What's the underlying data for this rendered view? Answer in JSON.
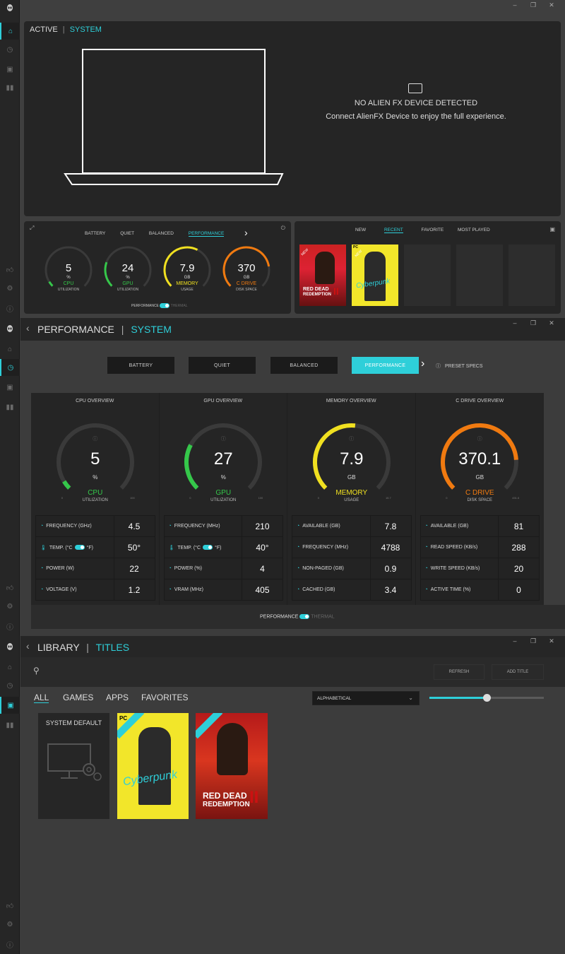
{
  "colors": {
    "accent": "#2ecfd9",
    "cpu": "#35c74a",
    "gpu": "#35c74a",
    "memory": "#f0e020",
    "cdrive": "#f07a10"
  },
  "window_controls": [
    "–",
    "❐",
    "✕"
  ],
  "home": {
    "breadcrumb": {
      "left": "ACTIVE",
      "sep": "|",
      "right": "SYSTEM"
    },
    "alienfx": {
      "title": "NO ALIEN FX DEVICE DETECTED",
      "message": "Connect AlienFX Device to enjoy the full experience."
    },
    "perf_tabs": [
      "BATTERY",
      "QUIET",
      "BALANCED",
      "PERFORMANCE"
    ],
    "gauges": [
      {
        "value": "5",
        "unit": "%",
        "name": "CPU",
        "sub": "UTILIZATION",
        "fraction": 0.05
      },
      {
        "value": "24",
        "unit": "%",
        "name": "GPU",
        "sub": "UTILIZATION",
        "fraction": 0.24
      },
      {
        "value": "7.9",
        "unit": "GB",
        "name": "MEMORY",
        "sub": "USAGE",
        "fraction": 0.6
      },
      {
        "value": "370",
        "unit": "GB",
        "name": "C DRIVE",
        "sub": "DISK SPACE",
        "fraction": 0.8
      }
    ],
    "toggle_left": "PERFORMANCE",
    "toggle_right": "THERMAL",
    "library_tabs": [
      "NEW",
      "RECENT",
      "FAVORITE",
      "MOST PLAYED"
    ],
    "games": [
      {
        "title_line1": "RED DEAD",
        "title_line2": "REDEMPTION",
        "numeral": "II",
        "badge": "NEW"
      },
      {
        "title_line1": "Cyberpunk",
        "badge": "NEW",
        "platform": "PC"
      }
    ]
  },
  "performance": {
    "breadcrumb": {
      "left": "PERFORMANCE",
      "sep": "|",
      "right": "SYSTEM"
    },
    "modes": [
      "BATTERY",
      "QUIET",
      "BALANCED",
      "PERFORMANCE"
    ],
    "preset_specs": "PRESET SPECS",
    "overviews": [
      {
        "header": "CPU OVERVIEW",
        "value": "5",
        "unit": "%",
        "name": "CPU",
        "sub": "UTILIZATION",
        "fraction": 0.05,
        "min": "0",
        "max": "100",
        "rows": [
          {
            "k": "FREQUENCY (GHz)",
            "v": "4.5"
          },
          {
            "k": "TEMP. (°C",
            "k2": "°F)",
            "v": "50°"
          },
          {
            "k": "POWER (W)",
            "v": "22"
          },
          {
            "k": "VOLTAGE (V)",
            "v": "1.2"
          }
        ]
      },
      {
        "header": "GPU OVERVIEW",
        "value": "27",
        "unit": "%",
        "name": "GPU",
        "sub": "UTILIZATION",
        "fraction": 0.27,
        "min": "0",
        "max": "100",
        "rows": [
          {
            "k": "FREQUENCY (MHz)",
            "v": "210"
          },
          {
            "k": "TEMP. (°C",
            "k2": "°F)",
            "v": "40°"
          },
          {
            "k": "POWER (%)",
            "v": "4"
          },
          {
            "k": "VRAM (MHz)",
            "v": "405"
          }
        ]
      },
      {
        "header": "MEMORY OVERVIEW",
        "value": "7.9",
        "unit": "GB",
        "name": "MEMORY",
        "sub": "USAGE",
        "fraction": 0.52,
        "min": "0",
        "max": "15.7",
        "rows": [
          {
            "k": "AVAILABLE (GB)",
            "v": "7.8"
          },
          {
            "k": "FREQUENCY (MHz)",
            "v": "4788"
          },
          {
            "k": "NON-PAGED (GB)",
            "v": "0.9"
          },
          {
            "k": "CACHED (GB)",
            "v": "3.4"
          }
        ]
      },
      {
        "header": "C DRIVE OVERVIEW",
        "value": "370.1",
        "unit": "GB",
        "name": "C DRIVE",
        "sub": "DISK SPACE",
        "fraction": 0.82,
        "min": "0",
        "max": "451.6",
        "rows": [
          {
            "k": "AVAILABLE (GB)",
            "v": "81"
          },
          {
            "k": "READ SPEED (KB/s)",
            "v": "288"
          },
          {
            "k": "WRITE SPEED (KB/s)",
            "v": "20"
          },
          {
            "k": "ACTIVE TIME (%)",
            "v": "0"
          }
        ]
      }
    ],
    "toggle_left": "PERFORMANCE",
    "toggle_right": "THERMAL"
  },
  "library": {
    "breadcrumb": {
      "left": "LIBRARY",
      "sep": "|",
      "right": "TITLES"
    },
    "refresh": "REFRESH",
    "add_title": "ADD TITLE",
    "tabs": [
      "ALL",
      "GAMES",
      "APPS",
      "FAVORITES"
    ],
    "sort": "ALPHABETICAL",
    "slider_fraction": 0.5,
    "system_default": "SYSTEM DEFAULT"
  }
}
